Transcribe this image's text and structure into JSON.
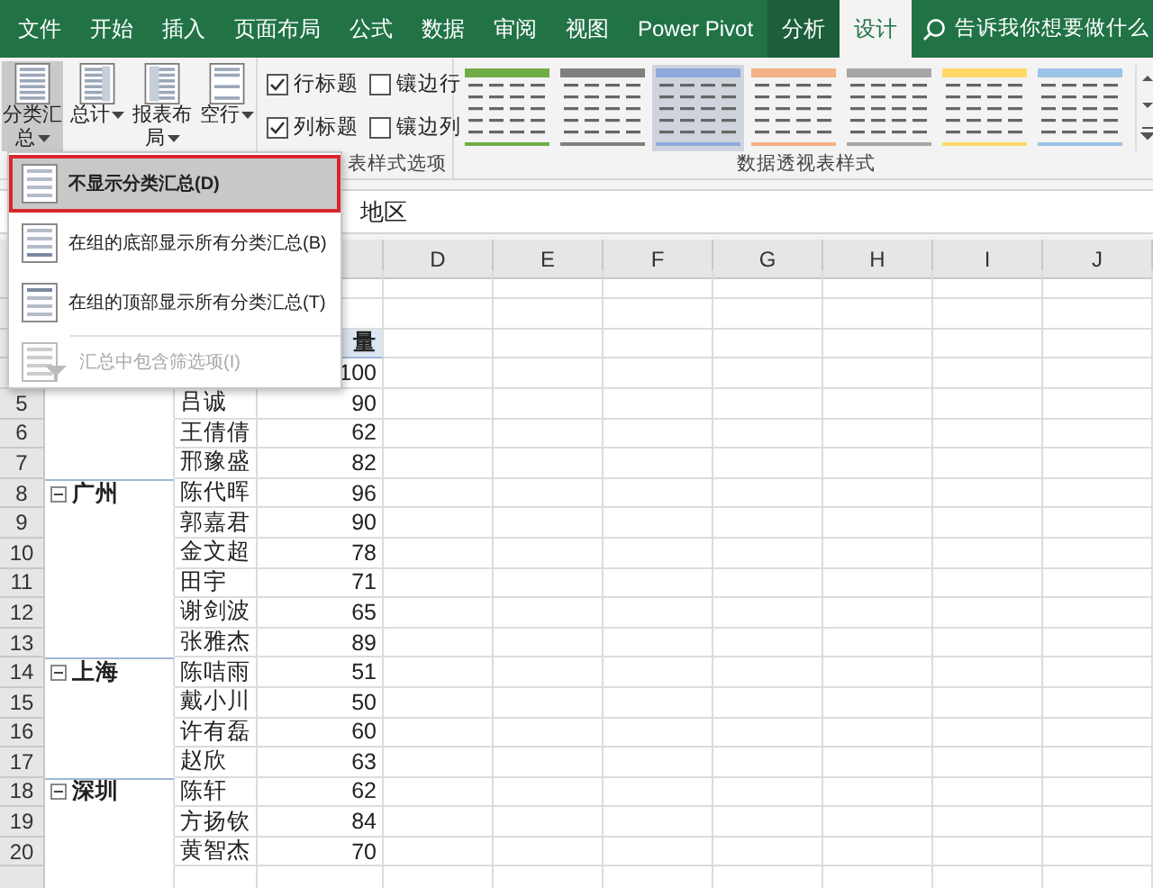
{
  "tabs": [
    {
      "label": "文件",
      "selected": false,
      "contextual": false
    },
    {
      "label": "开始",
      "selected": false,
      "contextual": false
    },
    {
      "label": "插入",
      "selected": false,
      "contextual": false
    },
    {
      "label": "页面布局",
      "selected": false,
      "contextual": false
    },
    {
      "label": "公式",
      "selected": false,
      "contextual": false
    },
    {
      "label": "数据",
      "selected": false,
      "contextual": false
    },
    {
      "label": "审阅",
      "selected": false,
      "contextual": false
    },
    {
      "label": "视图",
      "selected": false,
      "contextual": false
    },
    {
      "label": "Power Pivot",
      "selected": false,
      "contextual": false
    },
    {
      "label": "分析",
      "selected": false,
      "contextual": true
    },
    {
      "label": "设计",
      "selected": true,
      "contextual": true
    }
  ],
  "tell_me": {
    "placeholder": "告诉我你想要做什么"
  },
  "ribbon": {
    "layout_buttons": [
      {
        "label": "分类汇总",
        "pressed": true
      },
      {
        "label": "总计",
        "pressed": false
      },
      {
        "label": "报表布局",
        "pressed": false
      },
      {
        "label": "空行",
        "pressed": false
      }
    ],
    "options": [
      {
        "label": "行标题",
        "checked": true
      },
      {
        "label": "镶边行",
        "checked": false
      },
      {
        "label": "列标题",
        "checked": true
      },
      {
        "label": "镶边列",
        "checked": false
      }
    ],
    "options_group_label": "表样式选项",
    "styles": [
      {
        "color": "#70ad47",
        "selected": false
      },
      {
        "color": "#7f7f7f",
        "selected": false
      },
      {
        "color": "#8eaadb",
        "selected": true
      },
      {
        "color": "#f4b183",
        "selected": false
      },
      {
        "color": "#a6a6a6",
        "selected": false
      },
      {
        "color": "#ffd966",
        "selected": false
      },
      {
        "color": "#9dc3e6",
        "selected": false
      }
    ],
    "styles_group_label": "数据透视表样式"
  },
  "formula_bar": {
    "value": "地区"
  },
  "sheet": {
    "columns": [
      "D",
      "E",
      "F",
      "G",
      "H",
      "I",
      "J"
    ],
    "header_cell": "量",
    "rows": [
      {
        "value": "100"
      },
      {
        "number": "5",
        "name": "吕诚",
        "value": "90"
      },
      {
        "number": "6",
        "name": "王倩倩",
        "value": "62"
      },
      {
        "number": "7",
        "name": "邢豫盛",
        "value": "82"
      },
      {
        "number": "8",
        "region": "广州",
        "name": "陈代晖",
        "value": "96"
      },
      {
        "number": "9",
        "name": "郭嘉君",
        "value": "90"
      },
      {
        "number": "10",
        "name": "金文超",
        "value": "78"
      },
      {
        "number": "11",
        "name": "田宇",
        "value": "71"
      },
      {
        "number": "12",
        "name": "谢剑波",
        "value": "65"
      },
      {
        "number": "13",
        "name": "张雅杰",
        "value": "89"
      },
      {
        "number": "14",
        "region": "上海",
        "name": "陈咭雨",
        "value": "51"
      },
      {
        "number": "15",
        "name": "戴小川",
        "value": "50"
      },
      {
        "number": "16",
        "name": "许有磊",
        "value": "60"
      },
      {
        "number": "17",
        "name": "赵欣",
        "value": "63"
      },
      {
        "number": "18",
        "region": "深圳",
        "name": "陈轩",
        "value": "62"
      },
      {
        "number": "19",
        "name": "方扬钦",
        "value": "84"
      },
      {
        "number": "20",
        "name": "黄智杰",
        "value": "70"
      }
    ]
  },
  "subtotal_menu": {
    "items": [
      {
        "label": "不显示分类汇总(D)",
        "selected": true,
        "disabled": false
      },
      {
        "label": "在组的底部显示所有分类汇总(B)",
        "selected": false,
        "disabled": false
      },
      {
        "label": "在组的顶部显示所有分类汇总(T)",
        "selected": false,
        "disabled": false
      },
      {
        "label": "汇总中包含筛选项(I)",
        "selected": false,
        "disabled": true
      }
    ]
  }
}
